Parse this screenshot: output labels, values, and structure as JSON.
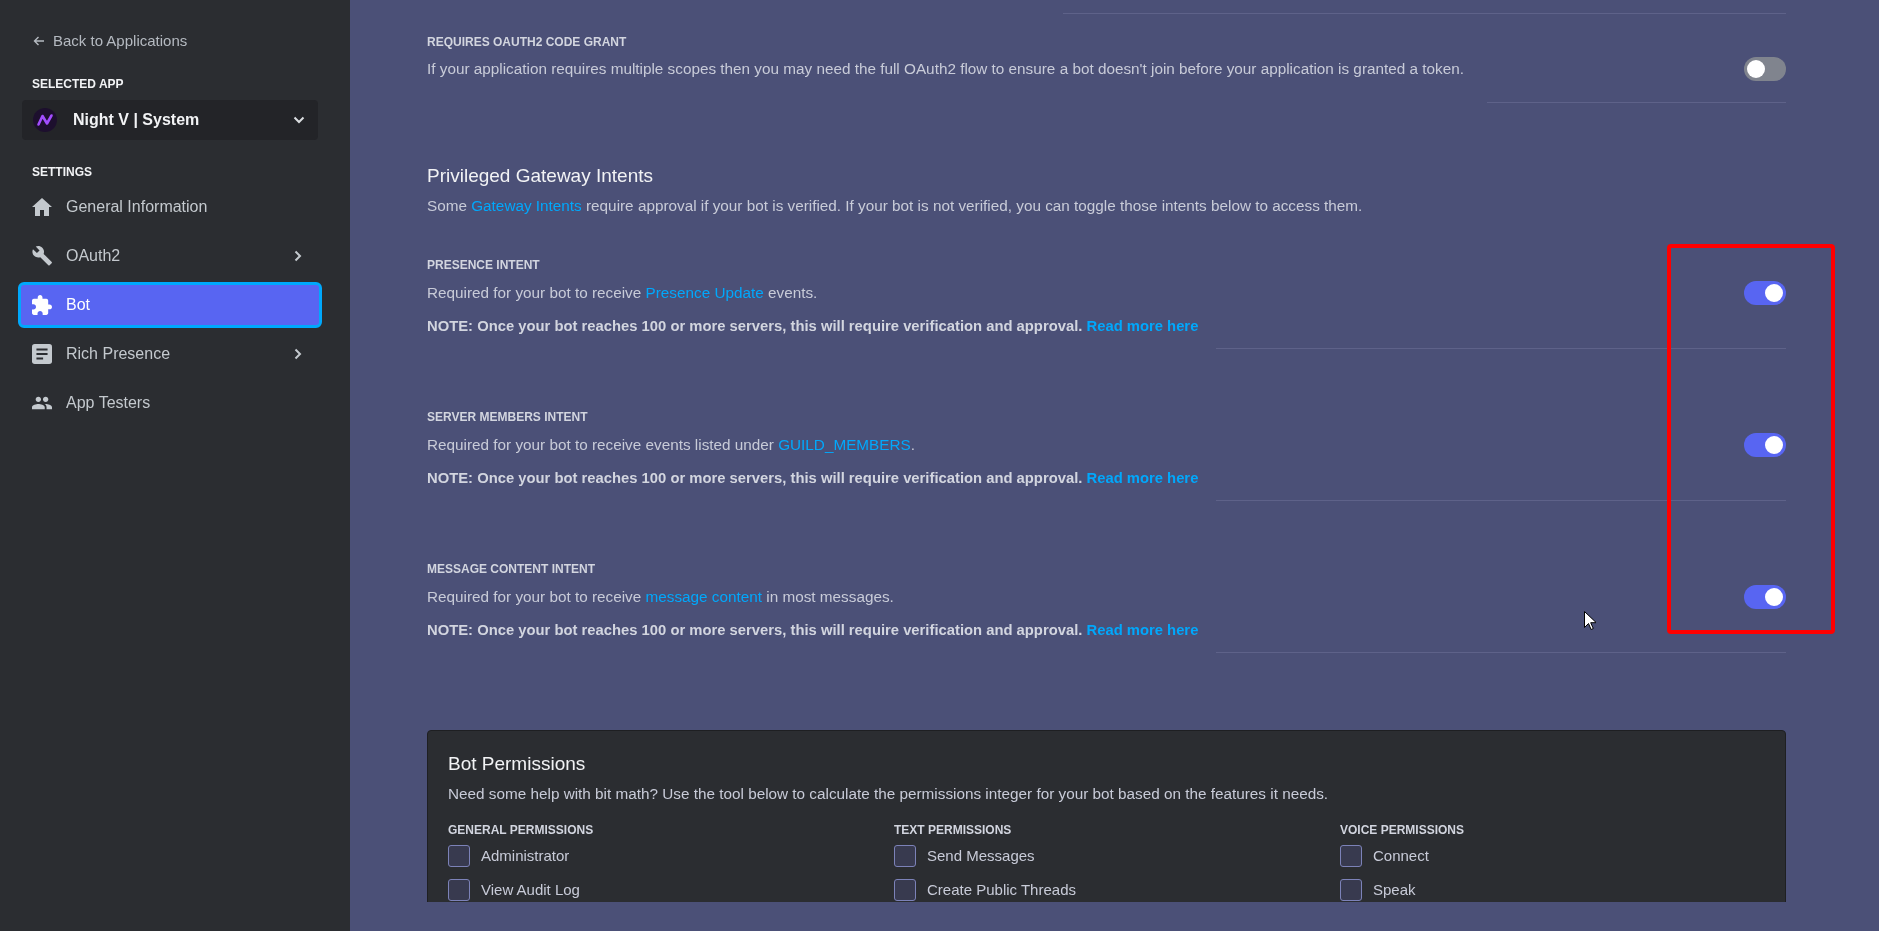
{
  "sidebar": {
    "back_link": "Back to Applications",
    "selected_app_heading": "SELECTED APP",
    "selected_app": "Night V | System",
    "settings_heading": "SETTINGS",
    "items": [
      {
        "label": "General Information",
        "has_submenu": false,
        "selected": false
      },
      {
        "label": "OAuth2",
        "has_submenu": true,
        "selected": false
      },
      {
        "label": "Bot",
        "has_submenu": false,
        "selected": true
      },
      {
        "label": "Rich Presence",
        "has_submenu": true,
        "selected": false
      },
      {
        "label": "App Testers",
        "has_submenu": false,
        "selected": false
      }
    ]
  },
  "code_grant": {
    "label": "REQUIRES OAUTH2 CODE GRANT",
    "description": "If your application requires multiple scopes then you may need the full OAuth2 flow to ensure a bot doesn't join before your application is granted a token.",
    "on": false
  },
  "intents": {
    "title": "Privileged Gateway Intents",
    "description": [
      {
        "kind": "text",
        "text": "Some "
      },
      {
        "kind": "link",
        "text": "Gateway Intents"
      },
      {
        "kind": "text",
        "text": " require approval if your bot is verified. If your bot is not verified, you can toggle those intents below to access them."
      }
    ],
    "items": [
      {
        "label": "PRESENCE INTENT",
        "description": [
          {
            "kind": "text",
            "text": "Required for your bot to receive "
          },
          {
            "kind": "link",
            "text": "Presence Update"
          },
          {
            "kind": "text",
            "text": " events."
          }
        ],
        "note": [
          {
            "kind": "text",
            "text": "NOTE: Once your bot reaches 100 or more servers, this will require verification and approval. "
          },
          {
            "kind": "link",
            "text": "Read more here"
          }
        ],
        "on": true
      },
      {
        "label": "SERVER MEMBERS INTENT",
        "description": [
          {
            "kind": "text",
            "text": "Required for your bot to receive events listed under "
          },
          {
            "kind": "link",
            "text": "GUILD_MEMBERS"
          },
          {
            "kind": "text",
            "text": "."
          }
        ],
        "note": [
          {
            "kind": "text",
            "text": "NOTE: Once your bot reaches 100 or more servers, this will require verification and approval. "
          },
          {
            "kind": "link",
            "text": "Read more here"
          }
        ],
        "on": true
      },
      {
        "label": "MESSAGE CONTENT INTENT",
        "description": [
          {
            "kind": "text",
            "text": "Required for your bot to receive "
          },
          {
            "kind": "link",
            "text": "message content"
          },
          {
            "kind": "text",
            "text": " in most messages."
          }
        ],
        "note": [
          {
            "kind": "text",
            "text": "NOTE: Once your bot reaches 100 or more servers, this will require verification and approval. "
          },
          {
            "kind": "link",
            "text": "Read more here"
          }
        ],
        "on": true
      }
    ]
  },
  "permissions": {
    "title": "Bot Permissions",
    "description": "Need some help with bit math? Use the tool below to calculate the permissions integer for your bot based on the features it needs.",
    "columns": [
      {
        "heading": "GENERAL PERMISSIONS",
        "items": [
          {
            "label": "Administrator",
            "checked": false
          },
          {
            "label": "View Audit Log",
            "checked": false
          }
        ]
      },
      {
        "heading": "TEXT PERMISSIONS",
        "items": [
          {
            "label": "Send Messages",
            "checked": false
          },
          {
            "label": "Create Public Threads",
            "checked": false
          }
        ]
      },
      {
        "heading": "VOICE PERMISSIONS",
        "items": [
          {
            "label": "Connect",
            "checked": false
          },
          {
            "label": "Speak",
            "checked": false
          }
        ]
      }
    ]
  }
}
